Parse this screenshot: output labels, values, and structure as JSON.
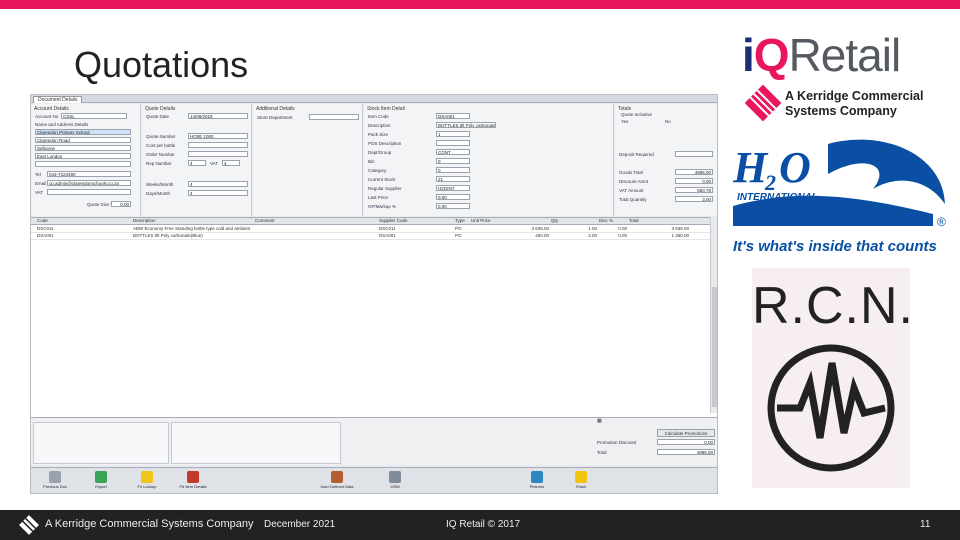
{
  "slide": {
    "title": "Quotations",
    "footer": {
      "brand": "A Kerridge Commercial Systems Company",
      "date": "December 2021",
      "copyright": "IQ Retail © 2017",
      "page_number": "11"
    }
  },
  "logos": {
    "iq": {
      "i": "i",
      "q": "Q",
      "retail": "Retail"
    },
    "kerridge": {
      "line1": "A Kerridge Commercial",
      "line2": "Systems Company"
    },
    "h2o": {
      "name": "H2O",
      "sub": "INTERNATIONAL",
      "registered": "®",
      "tagline": "It's what's inside that counts"
    },
    "rcn": {
      "text": "R.C.N."
    }
  },
  "colors": {
    "accent": "#e8175d",
    "iq_blue": "#1b2d73",
    "h2o_blue": "#0a4fa3"
  },
  "app": {
    "tab": "Document Details",
    "account": {
      "title": "Account Details",
      "account_label": "Account No",
      "account_value": "CSSL",
      "address_label": "Name and Address Details",
      "address_lines": [
        "Clarendon Primary School",
        "Clarendon Road",
        "Selborne",
        "East London"
      ],
      "tel_label": "Tel",
      "tel_value": "043-7223490",
      "email_label": "Email",
      "email_value": "cp.admin@clarendonschools.co.za",
      "vat_label": "VAT",
      "disc_label": "Quote Disc %",
      "disc_value": "0.00"
    },
    "quote": {
      "title": "Quote Details",
      "date_label": "Quote Date",
      "date_value": "14/08/2019",
      "number_label": "Quote Number",
      "number_value": "HQ0E 1000",
      "costsee_label": "Cost per bottle",
      "order_label": "Order Number",
      "rep_label": "Rep Number",
      "rep_value": "4",
      "vat_label": "VAT",
      "vat_value": "4",
      "weeks_label": "Weeks/Month",
      "weeks_value": "4",
      "days_label": "Days/Month",
      "days_value": "4"
    },
    "additional": {
      "title": "Additional Details",
      "store_label": "Store Department"
    },
    "stock": {
      "title": "Stock Item Detail",
      "rows": [
        {
          "label": "Item Code",
          "value": "DSA001"
        },
        {
          "label": "Description",
          "value": "BOTTLES 5lt Poly carbonate"
        },
        {
          "label": "Pack Size",
          "value": "1"
        },
        {
          "label": "POS Description",
          "value": ""
        },
        {
          "label": "Dept/Group",
          "value": "CONT"
        },
        {
          "label": "Bin",
          "value": "0"
        },
        {
          "label": "Category",
          "value": "0"
        },
        {
          "label": "Current Stock",
          "value": "21"
        },
        {
          "label": "Regular Supplier",
          "value": "H2OINT"
        },
        {
          "label": "Last Price",
          "value": "0.00"
        },
        {
          "label": "GP/Markup %",
          "value": "0.00"
        }
      ]
    },
    "totals": {
      "title": "Totals",
      "inclusive_label": "Quote Inclusive",
      "yes_label": "Yes",
      "no_label": "No",
      "deposit_label": "Deposit Required",
      "rows": [
        {
          "label": "Goods Total",
          "value": "4985.00"
        },
        {
          "label": "Discount Amnt",
          "value": "0.00"
        },
        {
          "label": "VAT Amount",
          "value": "650.78"
        },
        {
          "label": "Total Quantity",
          "value": "3.00"
        }
      ]
    },
    "grid": {
      "headers": [
        "Code",
        "Description",
        "Comment",
        "Supplier Code",
        "Type",
        "Unit Price",
        "Qty",
        "Disc %",
        "Total"
      ],
      "rows": [
        [
          "DSC011",
          "ABW Economy Free Standing bottle type cold and ambient",
          "",
          "DSC011",
          "PO",
          "3 635.00",
          "1.00",
          "0.00",
          "3 635.00"
        ],
        [
          "DSA001",
          "BOTTLES 5lt Poly carbonate(Blue)",
          "",
          "DSA001",
          "PO",
          "450.00",
          "2.00",
          "0.00",
          "1 350.00"
        ]
      ]
    },
    "promo": {
      "calc_label": "Calculate Promotions",
      "discount_label": "Promotion Discount",
      "discount_value": "0.00",
      "total_label": "Total",
      "total_value": "4985.00"
    },
    "toolbar": [
      {
        "label": "Previous Doc",
        "icon": "document-icon",
        "color": "#9aa3ad"
      },
      {
        "label": "Export",
        "icon": "export-icon",
        "color": "#3aa35a"
      },
      {
        "label": "F4 Lookup",
        "icon": "lightbulb-icon",
        "color": "#f0c419"
      },
      {
        "label": "F6 Item Details",
        "icon": "item-details-icon",
        "color": "#c0392b"
      },
      {
        "label": "User Defined Data",
        "icon": "user-data-icon",
        "color": "#b55d2f"
      },
      {
        "label": "CRM",
        "icon": "crm-icon",
        "color": "#7f8c9a"
      },
      {
        "label": "Pictures",
        "icon": "picture-icon",
        "color": "#2e86c1"
      },
      {
        "label": "Flash",
        "icon": "flash-icon",
        "color": "#f1c40f"
      }
    ]
  }
}
